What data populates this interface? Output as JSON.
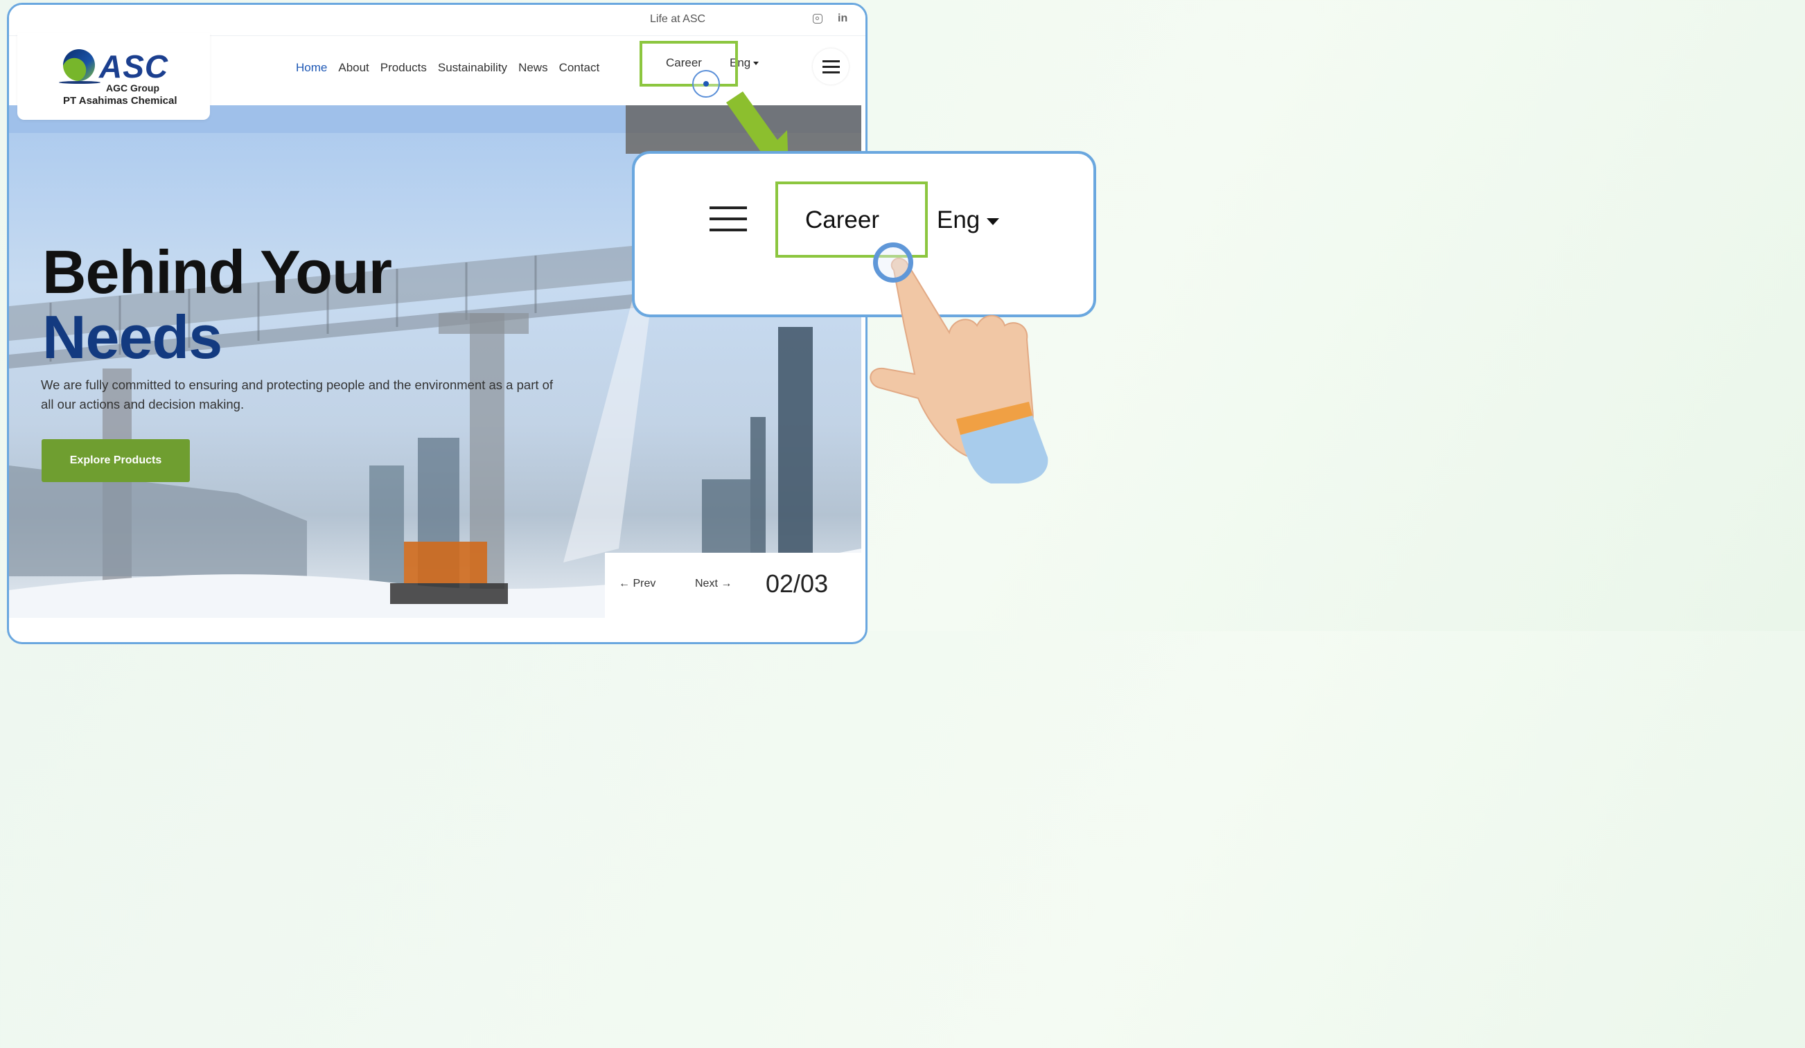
{
  "topbar": {
    "life_label": "Life at ASC",
    "instagram_icon": "instagram-icon",
    "linkedin_label": "in"
  },
  "logo": {
    "name": "ASC",
    "group": "AGC Group",
    "company": "PT Asahimas Chemical"
  },
  "nav": {
    "items": [
      {
        "label": "Home",
        "active": true
      },
      {
        "label": "About"
      },
      {
        "label": "Products"
      },
      {
        "label": "Sustainability"
      },
      {
        "label": "News"
      },
      {
        "label": "Contact"
      }
    ],
    "career_label": "Career",
    "lang_label": "Eng"
  },
  "hero": {
    "title_line1": "Behind Your",
    "title_line2": "Needs",
    "description": "We are fully committed to ensuring and protecting people and the environment as a part of all our actions and decision making.",
    "cta_label": "Explore Products",
    "prev_label": "Prev",
    "next_label": "Next",
    "slide_counter": "02/03"
  },
  "zoom_callout": {
    "career_label": "Career",
    "lang_label": "Eng"
  },
  "colors": {
    "accent_green": "#8cc63f",
    "brand_blue": "#1e58b5",
    "button_green": "#6f9e30",
    "frame_blue": "#6aa7df"
  }
}
